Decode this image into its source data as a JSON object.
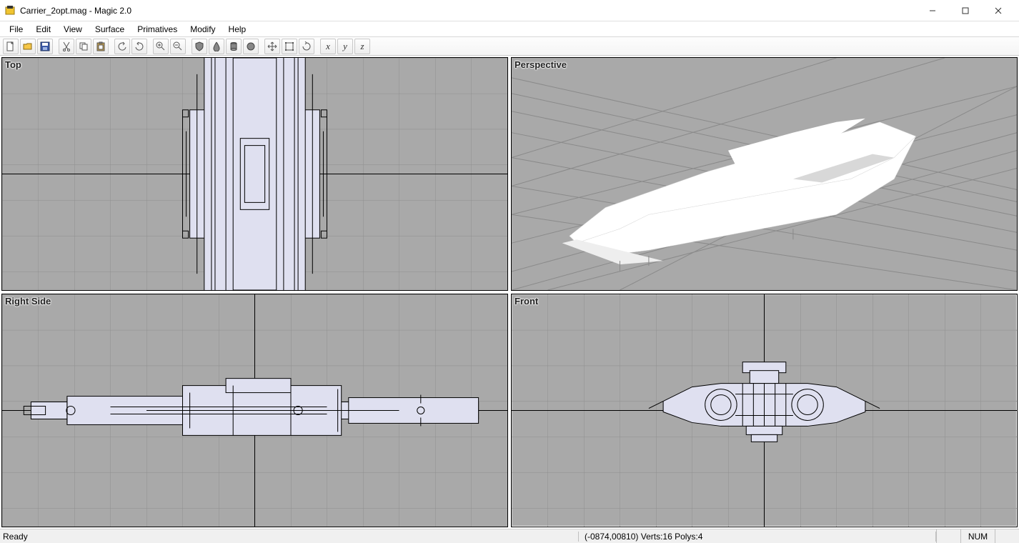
{
  "window": {
    "title": "Carrier_2opt.mag - Magic 2.0"
  },
  "menu": {
    "items": [
      "File",
      "Edit",
      "View",
      "Surface",
      "Primatives",
      "Modify",
      "Help"
    ]
  },
  "toolbar": {
    "groups": [
      [
        "new",
        "open",
        "save"
      ],
      [
        "cut",
        "copy",
        "paste"
      ],
      [
        "undo",
        "redo"
      ],
      [
        "zoom-in",
        "zoom-out"
      ],
      [
        "shield",
        "drop",
        "cylinder",
        "sphere"
      ],
      [
        "move",
        "resize",
        "rotate"
      ],
      [
        "axis-x",
        "axis-y",
        "axis-z"
      ]
    ]
  },
  "viewports": {
    "top": {
      "label": "Top"
    },
    "perspective": {
      "label": "Perspective"
    },
    "right": {
      "label": "Right Side"
    },
    "front": {
      "label": "Front"
    }
  },
  "status": {
    "ready": "Ready",
    "info": "(-0874,00810)  Verts:16 Polys:4",
    "num": "NUM"
  }
}
